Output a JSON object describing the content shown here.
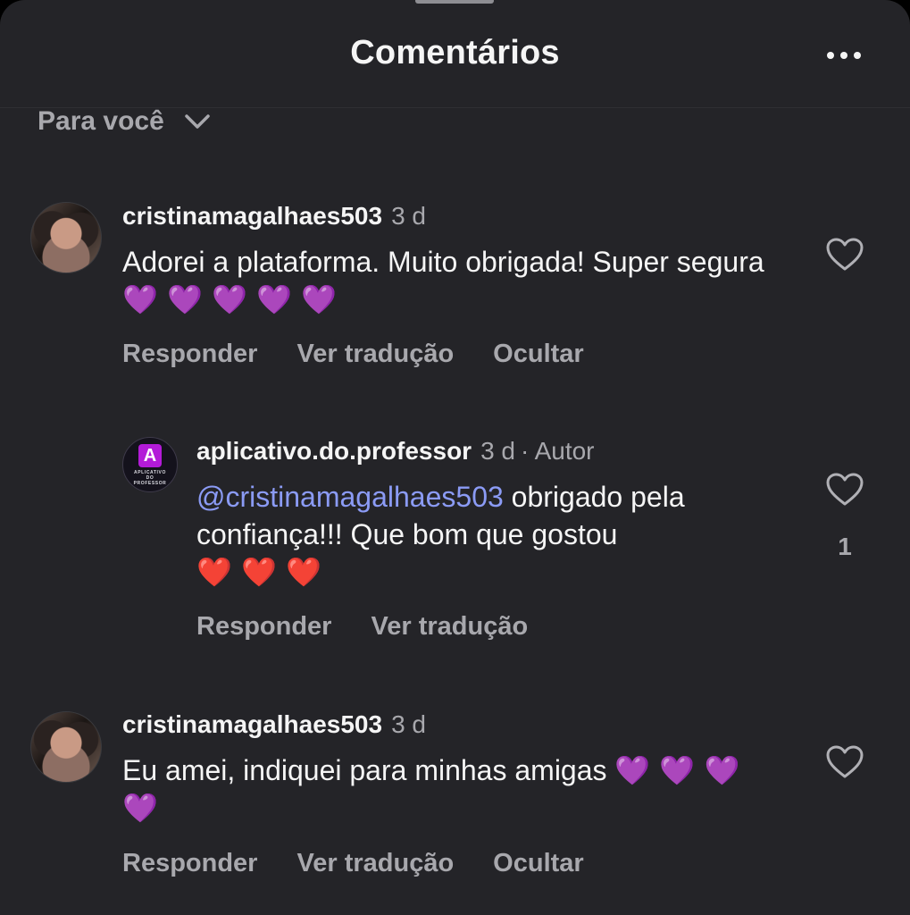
{
  "header": {
    "title": "Comentários",
    "more_icon": "more-horizontal-icon"
  },
  "sort": {
    "label": "Para você",
    "icon": "chevron-down-icon"
  },
  "colors": {
    "background": "#242428",
    "text_primary": "#f5f5f5",
    "text_secondary": "#a8a8ad",
    "mention": "#8b9bf5",
    "brand": "#b31bd8"
  },
  "comments": [
    {
      "username": "cristinamagalhaes503",
      "time": "3 d",
      "text": "Adorei a plataforma. Muito obrigada! Super segura",
      "emojis": "💜 💜 💜 💜 💜",
      "actions": [
        "Responder",
        "Ver tradução",
        "Ocultar"
      ],
      "like_icon": "heart-outline-icon"
    },
    {
      "username": "aplicativo.do.professor",
      "time": "3 d",
      "author_badge": "· Autor",
      "avatar_letter": "A",
      "avatar_caption": "APLICATIVO DO PROFESSOR",
      "mention": "@cristinamagalhaes503",
      "text": " obrigado pela confiança!!! Que bom que gostou",
      "emojis": "❤️ ❤️ ❤️",
      "actions": [
        "Responder",
        "Ver tradução"
      ],
      "like_icon": "heart-outline-icon",
      "like_count": "1"
    },
    {
      "username": "cristinamagalhaes503",
      "time": "3 d",
      "text": "Eu amei, indiquei para minhas amigas",
      "emojis": "💜 💜 💜 💜",
      "actions": [
        "Responder",
        "Ver tradução",
        "Ocultar"
      ],
      "like_icon": "heart-outline-icon"
    }
  ]
}
